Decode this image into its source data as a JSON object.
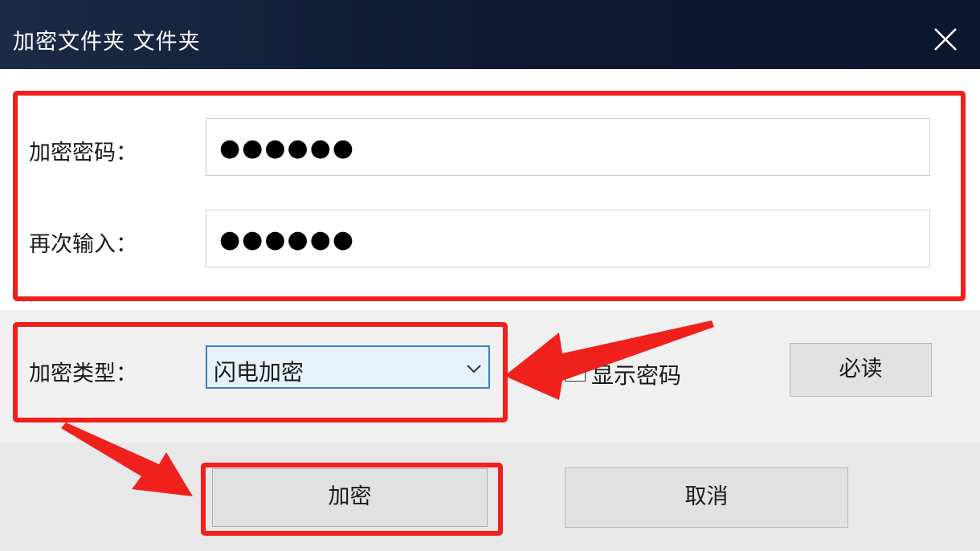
{
  "window": {
    "title": "加密文件夹 文件夹",
    "close_icon": "close-icon"
  },
  "form": {
    "password_label": "加密密码：",
    "password_value": "●●●●●●",
    "confirm_label": "再次输入：",
    "confirm_value": "●●●●●●",
    "type_label": "加密类型：",
    "type_selected": "闪电加密",
    "show_password_label": "显示密码",
    "show_password_checked": false
  },
  "buttons": {
    "read_me": "必读",
    "encrypt": "加密",
    "cancel": "取消"
  },
  "annotations": {
    "highlight_color": "#f0201c"
  }
}
